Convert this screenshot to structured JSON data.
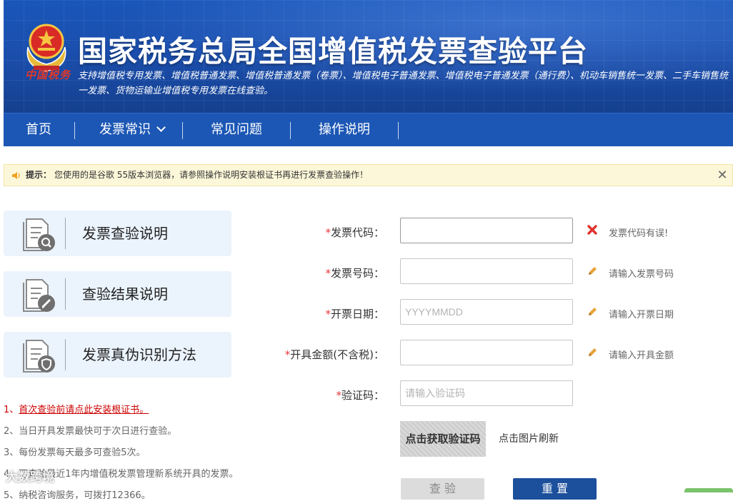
{
  "header": {
    "emblem_text": "中国税务",
    "title": "国家税务总局全国增值税发票查验平台",
    "subtitle": "支持增值税专用发票、增值税普通发票、增值税普通发票（卷票）、增值税电子普通发票、增值税电子普通发票（通行费）、机动车销售统一发票、二手车销售统一发票、货物运输业增值税专用发票在线查验。"
  },
  "nav": {
    "items": [
      {
        "label": "首页"
      },
      {
        "label": "发票常识",
        "dropdown": true
      },
      {
        "label": "常见问题"
      },
      {
        "label": "操作说明"
      }
    ]
  },
  "notice": {
    "label": "提示：",
    "text": "您使用的是谷歌 55版本浏览器，请参照操作说明安装根证书再进行发票查验操作！",
    "close": "✕"
  },
  "cards": [
    {
      "label": "发票查验说明",
      "icon": "document-search-icon"
    },
    {
      "label": "查验结果说明",
      "icon": "document-edit-icon"
    },
    {
      "label": "发票真伪识别方法",
      "icon": "document-shield-icon"
    }
  ],
  "notes": [
    {
      "prefix": "1、",
      "link": "首次查验前请点此安装根证书。"
    },
    {
      "text": "2、当日开具发票最快可于次日进行查验。"
    },
    {
      "text": "3、每份发票每天最多可查验5次。"
    },
    {
      "text": "4、可查验最近1年内增值税发票管理新系统开具的发票。"
    },
    {
      "text": "5、纳税咨询服务，可拨打12366。"
    }
  ],
  "form": {
    "required_mark": "*",
    "fields": [
      {
        "label": "发票代码：",
        "value": "",
        "placeholder": "",
        "hint": "发票代码有误!",
        "hint_type": "error"
      },
      {
        "label": "发票号码：",
        "value": "",
        "placeholder": "",
        "hint": "请输入发票号码",
        "hint_type": "edit"
      },
      {
        "label": "开票日期：",
        "value": "",
        "placeholder": "YYYYMMDD",
        "hint": "请输入开票日期",
        "hint_type": "edit"
      },
      {
        "label": "开具金额(不含税)：",
        "value": "",
        "placeholder": "",
        "hint": "请输入开具金额",
        "hint_type": "edit"
      },
      {
        "label": "验证码：",
        "value": "",
        "placeholder": "请输入验证码"
      }
    ],
    "captcha_image_text": "点击获取验证码",
    "captcha_hint": "点击图片刷新",
    "query_button": "查 验",
    "reset_button": "重 置"
  },
  "watermark": "大数跨境",
  "colors": {
    "banner_blue": "#1b4fae",
    "nav_blue": "#1c57b5",
    "required_red": "#e4393c",
    "error_red": "#e0332e",
    "edit_orange": "#e8a33a",
    "notice_bg": "#fdf7d9",
    "card_bg": "#ebf3fc"
  }
}
